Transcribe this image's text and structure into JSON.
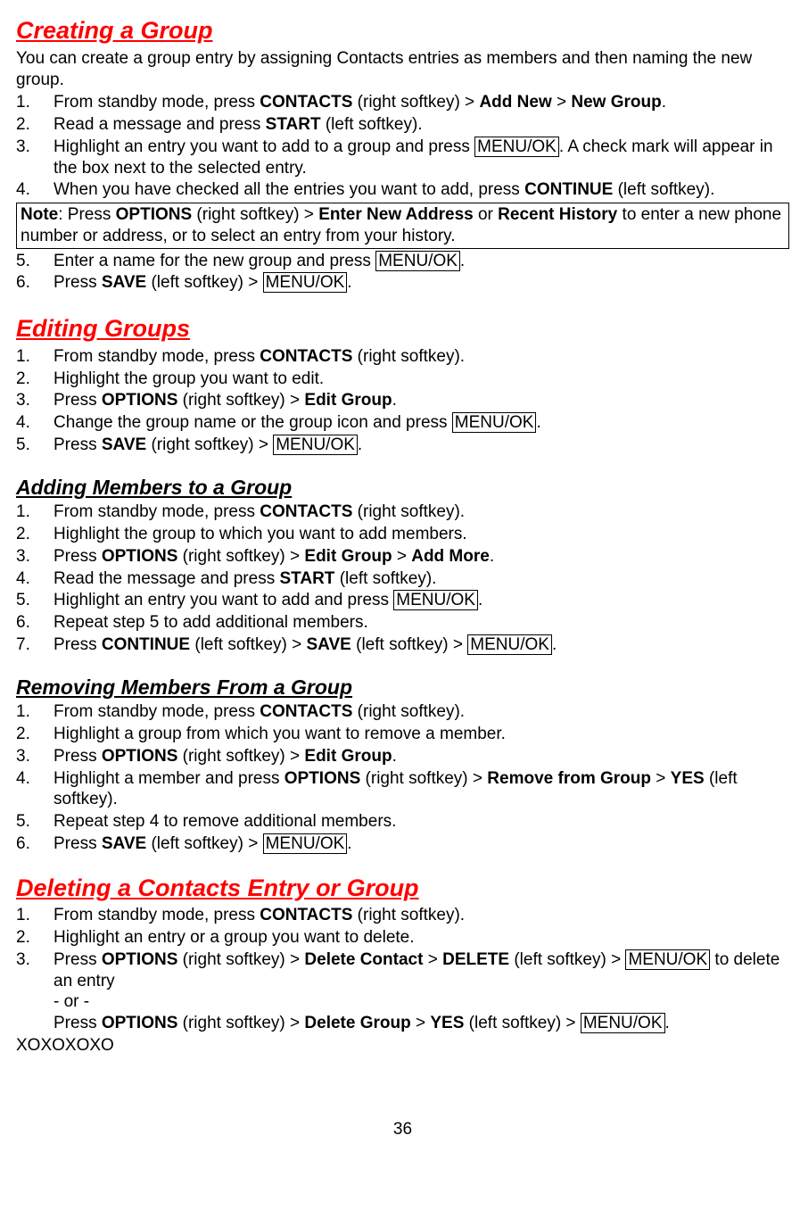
{
  "page_number": "36",
  "s1": {
    "title": "Creating a Group",
    "intro": "You can create a group entry by assigning Contacts entries as members and then naming the new group.",
    "items": [
      {
        "n": "1.",
        "pre": "From standby mode, press ",
        "b1": "CONTACTS",
        "mid1": " (right softkey) > ",
        "b2": "Add New",
        "mid2": " > ",
        "b3": "New Group",
        "post": "."
      },
      {
        "n": "2.",
        "pre": "Read a message and press ",
        "b1": "START",
        "post": " (left softkey)."
      },
      {
        "n": "3.",
        "pre": "Highlight an entry you want to add to a group and press ",
        "k1": "MENU/OK",
        "post": ". A check mark will appear in the box next to the selected entry."
      },
      {
        "n": "4.",
        "pre": "When you have checked all the entries you want to add, press ",
        "b1": "CONTINUE",
        "post": " (left softkey)."
      }
    ],
    "note_label": "Note",
    "note_pre": ": Press ",
    "note_b1": "OPTIONS",
    "note_mid1": " (right softkey) > ",
    "note_b2": "Enter New Address",
    "note_mid2": " or ",
    "note_b3": "Recent History",
    "note_post": " to enter a new phone number or address, or to select an entry from your history.",
    "items2": [
      {
        "n": "5.",
        "pre": "Enter a name for the new group and press ",
        "k1": "MENU/OK",
        "post": "."
      },
      {
        "n": "6.",
        "pre": "Press ",
        "b1": "SAVE",
        "mid1": " (left softkey) > ",
        "k1": "MENU/OK",
        "post": "."
      }
    ]
  },
  "s2": {
    "title": "Editing Groups",
    "items": [
      {
        "n": "1.",
        "pre": "From standby mode, press ",
        "b1": "CONTACTS",
        "post": " (right softkey)."
      },
      {
        "n": "2.",
        "pre": "Highlight the group you want to edit."
      },
      {
        "n": "3.",
        "pre": "Press ",
        "b1": "OPTIONS",
        "mid1": " (right softkey) > ",
        "b2": "Edit Group",
        "post": "."
      },
      {
        "n": "4.",
        "pre": "Change the group name or the group icon and press ",
        "k1": "MENU/OK",
        "post": "."
      },
      {
        "n": "5.",
        "pre": "Press ",
        "b1": "SAVE",
        "mid1": " (right softkey) > ",
        "k1": "MENU/OK",
        "post": "."
      }
    ]
  },
  "s3": {
    "title": "Adding Members to a Group",
    "items": [
      {
        "n": "1.",
        "pre": "From standby mode, press ",
        "b1": "CONTACTS",
        "post": " (right softkey)."
      },
      {
        "n": "2.",
        "pre": "Highlight the group to which you want to add members."
      },
      {
        "n": "3.",
        "pre": "Press ",
        "b1": "OPTIONS",
        "mid1": " (right softkey) > ",
        "b2": "Edit Group",
        "mid2": " > ",
        "b3": "Add More",
        "post": "."
      },
      {
        "n": "4.",
        "pre": "Read the message and press ",
        "b1": "START",
        "post": " (left softkey)."
      },
      {
        "n": "5.",
        "pre": "Highlight an entry you want to add and press ",
        "k1": "MENU/OK",
        "post": "."
      },
      {
        "n": "6.",
        "pre": "Repeat step 5 to add additional members."
      },
      {
        "n": "7.",
        "pre": "Press ",
        "b1": "CONTINUE",
        "mid1": " (left softkey) > ",
        "b2": "SAVE",
        "mid2": " (left softkey) > ",
        "k1": "MENU/OK",
        "post": "."
      }
    ]
  },
  "s4": {
    "title": "Removing Members From a Group",
    "items": [
      {
        "n": "1.",
        "pre": "From standby mode, press ",
        "b1": "CONTACTS",
        "post": " (right softkey)."
      },
      {
        "n": "2.",
        "pre": "Highlight a group from which you want to remove a member."
      },
      {
        "n": "3.",
        "pre": "Press ",
        "b1": "OPTIONS",
        "mid1": " (right softkey) > ",
        "b2": "Edit Group",
        "post": "."
      },
      {
        "n": "4.",
        "pre": "Highlight a member and press ",
        "b1": "OPTIONS",
        "mid1": " (right softkey) > ",
        "b2": "Remove from Group",
        "mid2": " > ",
        "b3": "YES",
        "post": " (left softkey)."
      },
      {
        "n": "5.",
        "pre": "Repeat step 4 to remove additional members."
      },
      {
        "n": "6.",
        "pre": "Press ",
        "b1": "SAVE",
        "mid1": " (left softkey) > ",
        "k1": "MENU/OK",
        "post": "."
      }
    ]
  },
  "s5": {
    "title": "Deleting a Contacts Entry or Group",
    "items": [
      {
        "n": "1.",
        "pre": "From standby mode, press ",
        "b1": "CONTACTS",
        "post": " (right softkey)."
      },
      {
        "n": "2.",
        "pre": "Highlight an entry or a group you want to delete."
      }
    ],
    "item3_n": "3.",
    "item3_line1_pre": "Press ",
    "item3_line1_b1": "OPTIONS",
    "item3_line1_mid1": " (right softkey) > ",
    "item3_line1_b2": "Delete Contact",
    "item3_line1_mid2": " > ",
    "item3_line1_b3": "DELETE",
    "item3_line1_mid3": " (left softkey) > ",
    "item3_line1_k1": "MENU/OK",
    "item3_line1_post": " to delete an entry",
    "item3_or": "- or -",
    "item3_line2_pre": "Press ",
    "item3_line2_b1": "OPTIONS",
    "item3_line2_mid1": " (right softkey) > ",
    "item3_line2_b2": "Delete Group",
    "item3_line2_mid2": " > ",
    "item3_line2_b3": "YES",
    "item3_line2_mid3": " (left softkey) > ",
    "item3_line2_k1": "MENU/OK",
    "item3_line2_post": "."
  }
}
